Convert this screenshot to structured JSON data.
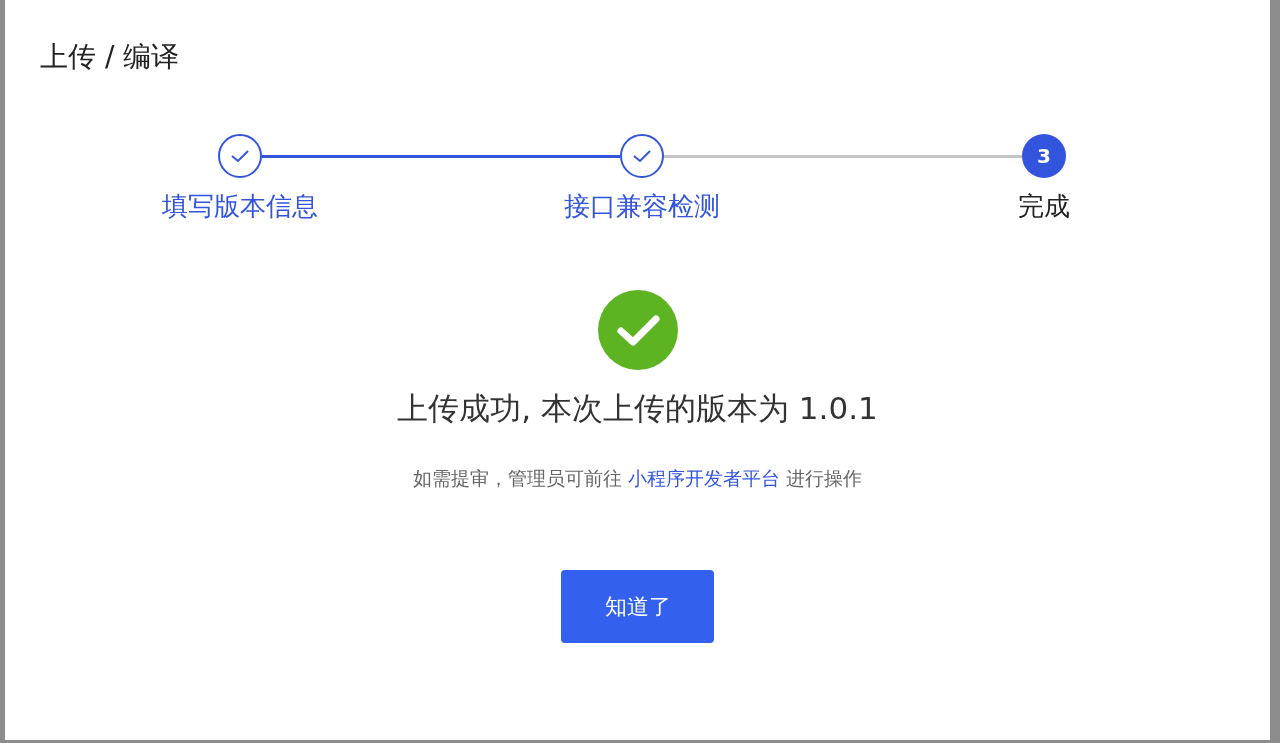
{
  "dialog": {
    "title": "上传 / 编译"
  },
  "steps": [
    {
      "label": "填写版本信息",
      "completed": true
    },
    {
      "label": "接口兼容检测",
      "completed": true
    },
    {
      "label": "完成",
      "completed": false,
      "number": "3"
    }
  ],
  "result": {
    "heading": "上传成功, 本次上传的版本为 1.0.1",
    "note_before": "如需提审，管理员可前往",
    "link": "小程序开发者平台",
    "note_after": "进行操作"
  },
  "button": {
    "label": "知道了"
  }
}
